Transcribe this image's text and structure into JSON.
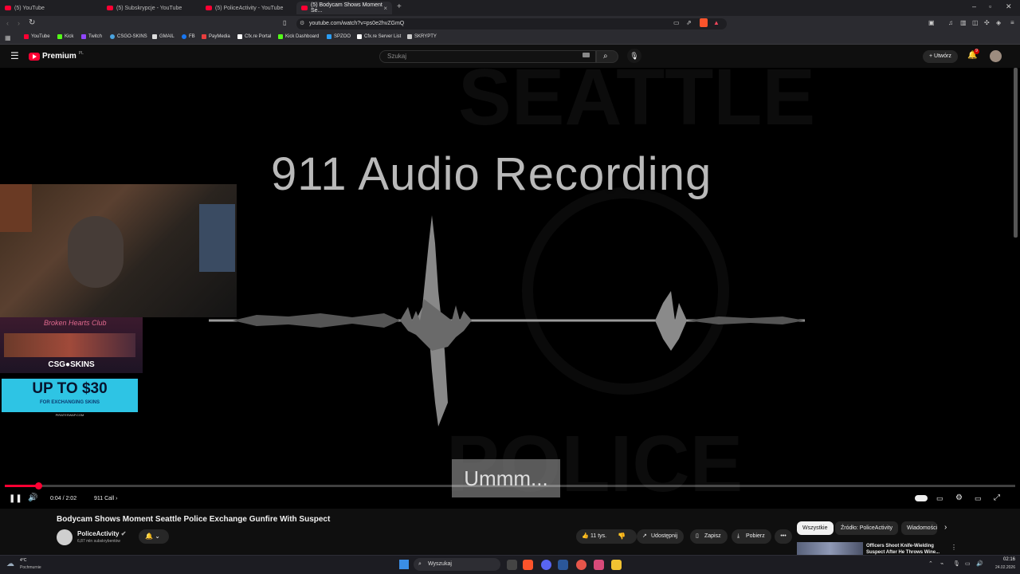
{
  "browser": {
    "tabs": [
      {
        "label": "(5) YouTube"
      },
      {
        "label": "(5) Subskrypcje - YouTube"
      },
      {
        "label": "(5) PoliceActivity - YouTube"
      },
      {
        "label": "(5) Bodycam Shows Moment Se..."
      }
    ],
    "url": "youtube.com/watch?v=ps0e2hvZGmQ",
    "bookmarks": [
      {
        "label": "YouTube",
        "color": "#ff0033"
      },
      {
        "label": "Kick",
        "color": "#53fc18"
      },
      {
        "label": "Twitch",
        "color": "#9146ff"
      },
      {
        "label": "CSGO-SKINS",
        "color": "#4aa3df"
      },
      {
        "label": "GMAIL",
        "color": "#dddddd"
      },
      {
        "label": "FB",
        "color": "#1877f2"
      },
      {
        "label": "PayMedia",
        "color": "#e83e3e"
      },
      {
        "label": "Cfx.re Portal",
        "color": "#ffffff"
      },
      {
        "label": "Kick Dashboard",
        "color": "#53fc18"
      },
      {
        "label": "SPZOO",
        "color": "#2a9df4"
      },
      {
        "label": "Cfx.re Server List",
        "color": "#ffffff"
      },
      {
        "label": "SKRYPTY",
        "color": "#cccccc"
      }
    ]
  },
  "youtube": {
    "logo": "Premium",
    "logo_region": "PL",
    "search_placeholder": "Szukaj",
    "create_label": "Utwórz",
    "notifications_count": "9"
  },
  "video": {
    "title_overlay": "911 Audio Recording",
    "subtitle": "Ummm...",
    "time": "0:04 / 2:02",
    "chapter": "911 Call",
    "progress": 0.033,
    "ad_brand": "CSG●SKINS",
    "ad_title": "Broken Hearts Club",
    "ad_offer": "UP TO $30",
    "ad_offer_sub": "FOR EXCHANGING SKINS",
    "ad_site": "PIRATESWAP.COM"
  },
  "meta": {
    "title": "Bodycam Shows Moment Seattle Police Exchange Gunfire With Suspect",
    "channel": "PoliceActivity",
    "subscribers": "6,87 mln subskrybentów",
    "likes": "11 tys.",
    "share": "Udostępnij",
    "save": "Zapisz",
    "download": "Pobierz"
  },
  "sidebar_chips": [
    "Wszystkie",
    "Źródło: PoliceActivity",
    "Wiadomości"
  ],
  "related": {
    "title": "Officers Shoot Knife-Wielding Suspect After He Throws Wine..."
  },
  "taskbar": {
    "weather_temp": "4°C",
    "weather_desc": "Pochmurnie",
    "search": "Wyszukaj",
    "time": "02:16",
    "date": "24.02.2026"
  }
}
